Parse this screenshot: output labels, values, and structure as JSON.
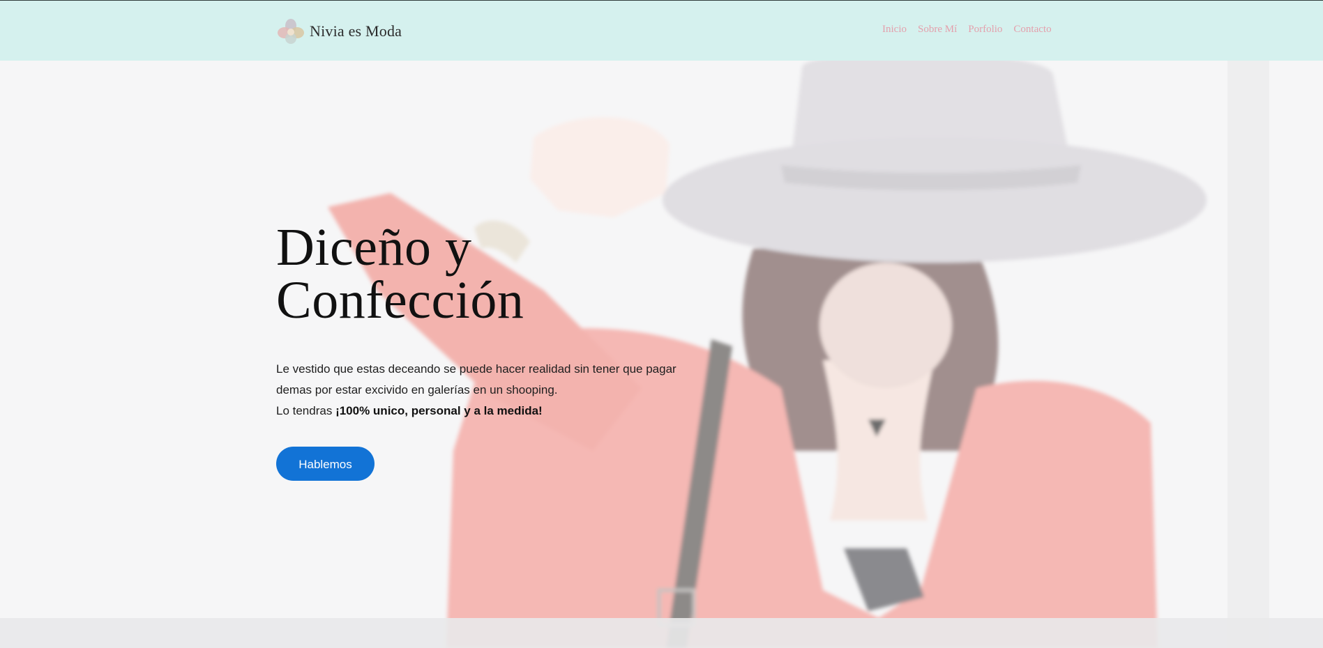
{
  "header": {
    "brand": "Nivia es Moda",
    "logo_icon": "logo-flower-icon",
    "nav": [
      "Inicio",
      "Sobre Mí",
      "Porfolio",
      "Contacto"
    ]
  },
  "hero": {
    "background_image": "woman-wearing-hat-photo",
    "title": "Diceño y Confección",
    "paragraph_line1": "Le vestido que estas deceando se puede hacer realidad sin tener que pagar demas por estar excivido en galerías en un shooping.",
    "paragraph_prefix": "Lo tendras ",
    "paragraph_bold": "¡100% unico, personal y a la medida!",
    "cta_label": "Hablemos"
  },
  "colors": {
    "header_bg": "#d5f1ee",
    "nav_link": "#e4a0ac",
    "cta_bg": "#1273d6"
  }
}
